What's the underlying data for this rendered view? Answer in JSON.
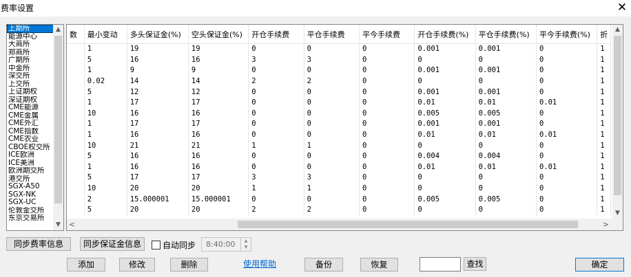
{
  "window": {
    "title": "费率设置",
    "close_glyph": "✕"
  },
  "exchanges": {
    "items": [
      "上期所",
      "能源中心",
      "大商所",
      "郑商所",
      "广期所",
      "中金所",
      "深交所",
      "上交所",
      "上证期权",
      "深证期权",
      "CME能源",
      "CME金属",
      "CME外汇",
      "CME指数",
      "CME农业",
      "CBOE权交所",
      "ICE欧洲",
      "ICE美洲",
      "欧洲期交所",
      "港交所",
      "SGX-A50",
      "SGX-NK",
      "SGX-UC",
      "伦敦金交所",
      "东京交易所"
    ],
    "selected_index": 0
  },
  "table": {
    "columns": [
      "数",
      "最小变动",
      "多头保证金(%)",
      "空头保证金(%)",
      "开仓手续费",
      "平仓手续费",
      "平今手续费",
      "开仓手续费(%)",
      "平仓手续费(%)",
      "平今手续费(%)",
      "折"
    ],
    "rows": [
      [
        "",
        "1",
        "19",
        "19",
        "0",
        "0",
        "0",
        "0.001",
        "0.001",
        "0",
        "1"
      ],
      [
        "",
        "5",
        "16",
        "16",
        "3",
        "3",
        "0",
        "0",
        "0",
        "0",
        "1"
      ],
      [
        "",
        "1",
        "9",
        "9",
        "0",
        "0",
        "0",
        "0.001",
        "0.001",
        "0",
        "1"
      ],
      [
        "",
        "0.02",
        "14",
        "14",
        "2",
        "2",
        "0",
        "0",
        "0",
        "0",
        "1"
      ],
      [
        "",
        "5",
        "12",
        "12",
        "0",
        "0",
        "0",
        "0.001",
        "0.001",
        "0",
        "1"
      ],
      [
        "",
        "1",
        "17",
        "17",
        "0",
        "0",
        "0",
        "0.01",
        "0.01",
        "0.01",
        "1"
      ],
      [
        "",
        "10",
        "16",
        "16",
        "0",
        "0",
        "0",
        "0.005",
        "0.005",
        "0",
        "1"
      ],
      [
        "",
        "1",
        "17",
        "17",
        "0",
        "0",
        "0",
        "0.001",
        "0.001",
        "0",
        "1"
      ],
      [
        "",
        "1",
        "16",
        "16",
        "0",
        "0",
        "0",
        "0.01",
        "0.01",
        "0.01",
        "1"
      ],
      [
        "",
        "10",
        "21",
        "21",
        "1",
        "1",
        "0",
        "0",
        "0",
        "0",
        "1"
      ],
      [
        "",
        "5",
        "16",
        "16",
        "0",
        "0",
        "0",
        "0.004",
        "0.004",
        "0",
        "1"
      ],
      [
        "",
        "1",
        "16",
        "16",
        "0",
        "0",
        "0",
        "0.01",
        "0.01",
        "0.01",
        "1"
      ],
      [
        "",
        "5",
        "17",
        "17",
        "3",
        "3",
        "0",
        "0",
        "0",
        "0",
        "1"
      ],
      [
        "",
        "10",
        "20",
        "20",
        "1",
        "1",
        "0",
        "0",
        "0",
        "0",
        "1"
      ],
      [
        "",
        "2",
        "15.000001",
        "15.000001",
        "0",
        "0",
        "0",
        "0.005",
        "0.005",
        "0",
        "1"
      ],
      [
        "",
        "5",
        "20",
        "20",
        "2",
        "2",
        "0",
        "0",
        "0",
        "0",
        "1"
      ]
    ]
  },
  "controls": {
    "sync_fee_label": "同步费率信息",
    "sync_margin_label": "同步保证金信息",
    "auto_sync_label": "自动同步",
    "auto_sync_checked": false,
    "sync_time": "8:40:00",
    "add_label": "添加",
    "modify_label": "修改",
    "delete_label": "删除",
    "help_label": "使用帮助",
    "backup_label": "备份",
    "restore_label": "恢复",
    "search_value": "",
    "find_label": "查找",
    "ok_label": "确定"
  },
  "icons": {
    "scroll_up": "chevron-up-icon",
    "scroll_down": "chevron-down-icon",
    "scroll_left": "chevron-left-icon",
    "scroll_right": "chevron-right-icon"
  },
  "colors": {
    "selection": "#0078d7",
    "link": "#0066cc"
  }
}
